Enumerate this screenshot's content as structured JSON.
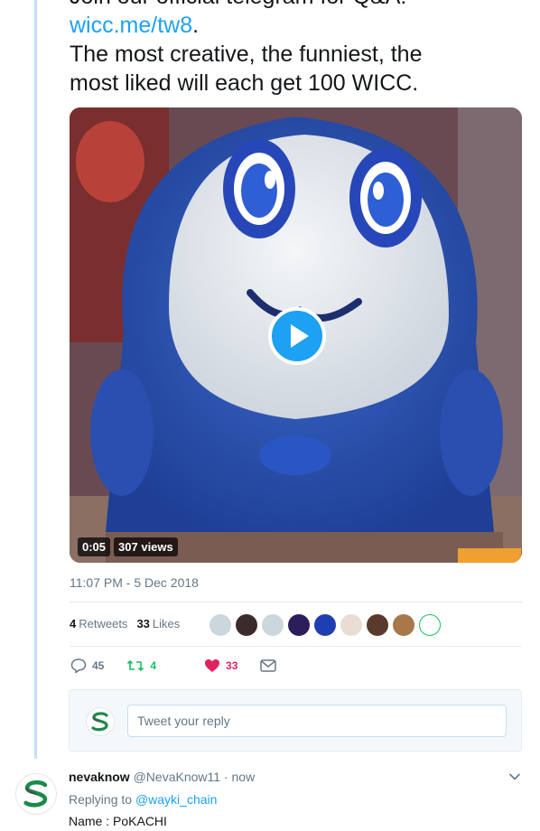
{
  "tweet": {
    "line1": "Join our official telegram for Q&A:",
    "link": "wicc.me/tw8",
    "link_suffix": ".",
    "line3": "The most creative, the funniest, the",
    "line4": "most liked will each get 100 WICC."
  },
  "media": {
    "duration": "0:05",
    "views": "307 views"
  },
  "timestamp": "11:07 PM - 5 Dec 2018",
  "stats": {
    "retweets_count": "4",
    "retweets_label": "Retweets",
    "likes_count": "33",
    "likes_label": "Likes"
  },
  "actions": {
    "reply_count": "45",
    "retweet_count": "4",
    "like_count": "33"
  },
  "composer": {
    "placeholder": "Tweet your reply"
  },
  "reply": {
    "display_name": "nevaknow",
    "handle": "@NevaKnow11",
    "separator": "·",
    "time": "now",
    "replying_prefix": "Replying to",
    "replying_to": "@wayki_chain",
    "text": "Name : PoKACHI"
  },
  "colors": {
    "accent": "#1da1f2",
    "retweet": "#17bf63",
    "like": "#e0245e",
    "secondary_text": "#657786"
  }
}
